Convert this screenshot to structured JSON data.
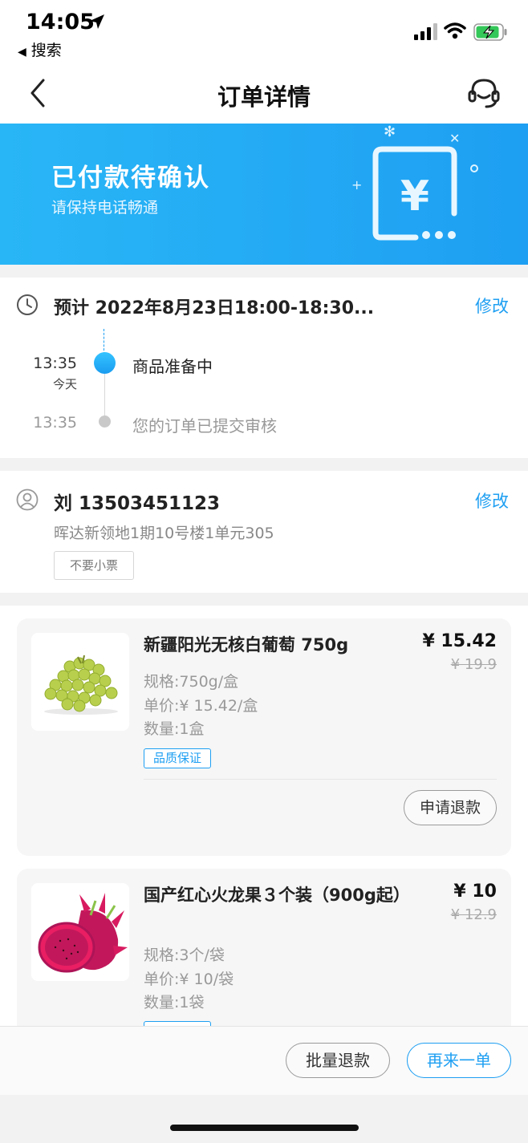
{
  "status_bar": {
    "time": "14:05",
    "back_app_label": "搜索"
  },
  "nav": {
    "title": "订单详情"
  },
  "banner": {
    "title": "已付款待确认",
    "subtitle": "请保持电话畅通",
    "icon_symbol": "¥"
  },
  "delivery": {
    "eta": "预计 2022年8月23日18:00-18:30...",
    "edit_label": "修改",
    "timeline": [
      {
        "time": "13:35",
        "day": "今天",
        "text": "商品准备中"
      },
      {
        "time": "13:35",
        "text": "您的订单已提交审核"
      }
    ]
  },
  "address": {
    "contact": "刘 13503451123",
    "address": "晖达新领地1期10号楼1单元305",
    "edit_label": "修改",
    "tag": "不要小票"
  },
  "products": [
    {
      "name": "新疆阳光无核白葡萄 750g",
      "price": "¥ 15.42",
      "original_price": "¥ 19.9",
      "spec": "规格:750g/盒",
      "unit_price": "单价:¥ 15.42/盒",
      "quantity": "数量:1盒",
      "tag": "品质保证",
      "refund_label": "申请退款",
      "image": "grapes"
    },
    {
      "name": "国产红心火龙果３个装（900g起）",
      "price": "¥ 10",
      "original_price": "¥ 12.9",
      "spec": "规格:3个/袋",
      "unit_price": "单价:¥ 10/袋",
      "quantity": "数量:1袋",
      "image": "dragon-fruit"
    }
  ],
  "footer": {
    "batch_refund_label": "批量退款",
    "reorder_label": "再来一单"
  },
  "colors": {
    "accent": "#1e9ff2",
    "banner": "#29b6f6"
  }
}
